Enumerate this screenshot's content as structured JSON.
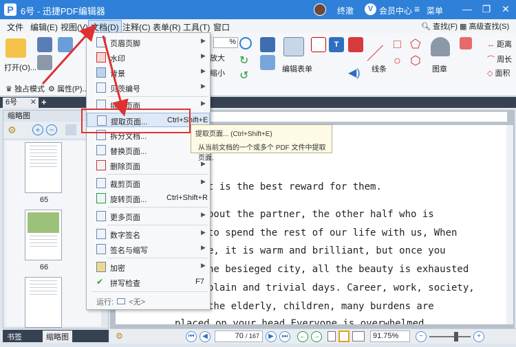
{
  "title": {
    "doc": "6号",
    "sep": "-",
    "app": "迅捷PDF编辑器",
    "user": "终澈",
    "vip_badge": "V",
    "member": "会员中心",
    "menu_label": "菜单",
    "min_glyph": "—",
    "max_glyph": "❐",
    "close_glyph": "✕"
  },
  "menubar": [
    "文件",
    "编辑(E)",
    "视图(V)",
    "文档(D)",
    "注释(C)",
    "表单(R)",
    "工具(T)",
    "窗口"
  ],
  "toolbar": {
    "open": "打开(O)...",
    "exclusive": "独占模式",
    "properties": "属性(P)...",
    "zoom_in": "放大",
    "zoom_out": "缩小",
    "zoom_value": "%",
    "edit_form": "编辑表单",
    "line": "线条",
    "stamp": "图章",
    "distance": "距离",
    "perimeter": "周长",
    "area": "面积",
    "find": "查找(F)",
    "advanced_find": "高级查找(S)"
  },
  "tab": {
    "label": "6号",
    "close": "✕",
    "add": "+"
  },
  "sidepanel": {
    "header": "缩略图",
    "pages": [
      "65",
      "66"
    ],
    "bottom_tabs": [
      "书签",
      "缩略图"
    ]
  },
  "document": {
    "lines": [
      "t is the best reward for them.",
      "bout  the  partner,  the  other  half  who  is",
      " to spend the rest of our life with us, When",
      "e,  it  is  warm  and  brilliant,  but  once  you",
      "he besieged city, all the beauty is exhausted",
      "plain and trivial days. Career, work, society,",
      "  the  elderly,  children,  many  burdens  are",
      "placed  on  your  head  Everyone  is  overwhelmed"
    ]
  },
  "status": {
    "page_current": "70",
    "page_total": "/ 167",
    "zoom": "91.75%"
  },
  "dropdown": {
    "items": [
      {
        "label": "页眉页脚",
        "shortcut": "",
        "submenu": true
      },
      {
        "label": "水印",
        "shortcut": "",
        "submenu": true
      },
      {
        "label": "背景",
        "shortcut": "",
        "submenu": true
      },
      {
        "label": "贝茨编号",
        "shortcut": "",
        "submenu": true
      },
      {
        "label": "插入页面",
        "shortcut": "",
        "submenu": true
      },
      {
        "label": "提取页面...",
        "shortcut": "Ctrl+Shift+E",
        "submenu": false
      },
      {
        "label": "拆分文档...",
        "shortcut": "",
        "submenu": false
      },
      {
        "label": "替换页面...",
        "shortcut": "",
        "submenu": false
      },
      {
        "label": "删除页面",
        "shortcut": "",
        "submenu": true
      },
      {
        "label": "裁剪页面",
        "shortcut": "",
        "submenu": true
      },
      {
        "label": "旋转页面...",
        "shortcut": "Ctrl+Shift+R",
        "submenu": false
      },
      {
        "label": "更多页面",
        "shortcut": "",
        "submenu": true
      },
      {
        "label": "数字签名",
        "shortcut": "",
        "submenu": true
      },
      {
        "label": "签名与缩写",
        "shortcut": "",
        "submenu": true
      },
      {
        "label": "加密",
        "shortcut": "",
        "submenu": true
      },
      {
        "label": "拼写检查",
        "shortcut": "F7",
        "submenu": false
      }
    ],
    "run_label": "运行:",
    "run_value": "<无>",
    "arrow_glyph": "▶"
  },
  "tooltip": {
    "title": "提取页面... (Ctrl+Shift+E)",
    "desc": "从当前文档的一个或多个 PDF 文件中提取页面."
  },
  "colors": {
    "titlebar": "#2f80d8",
    "highlight": "#e03030",
    "panel": "#364252"
  }
}
